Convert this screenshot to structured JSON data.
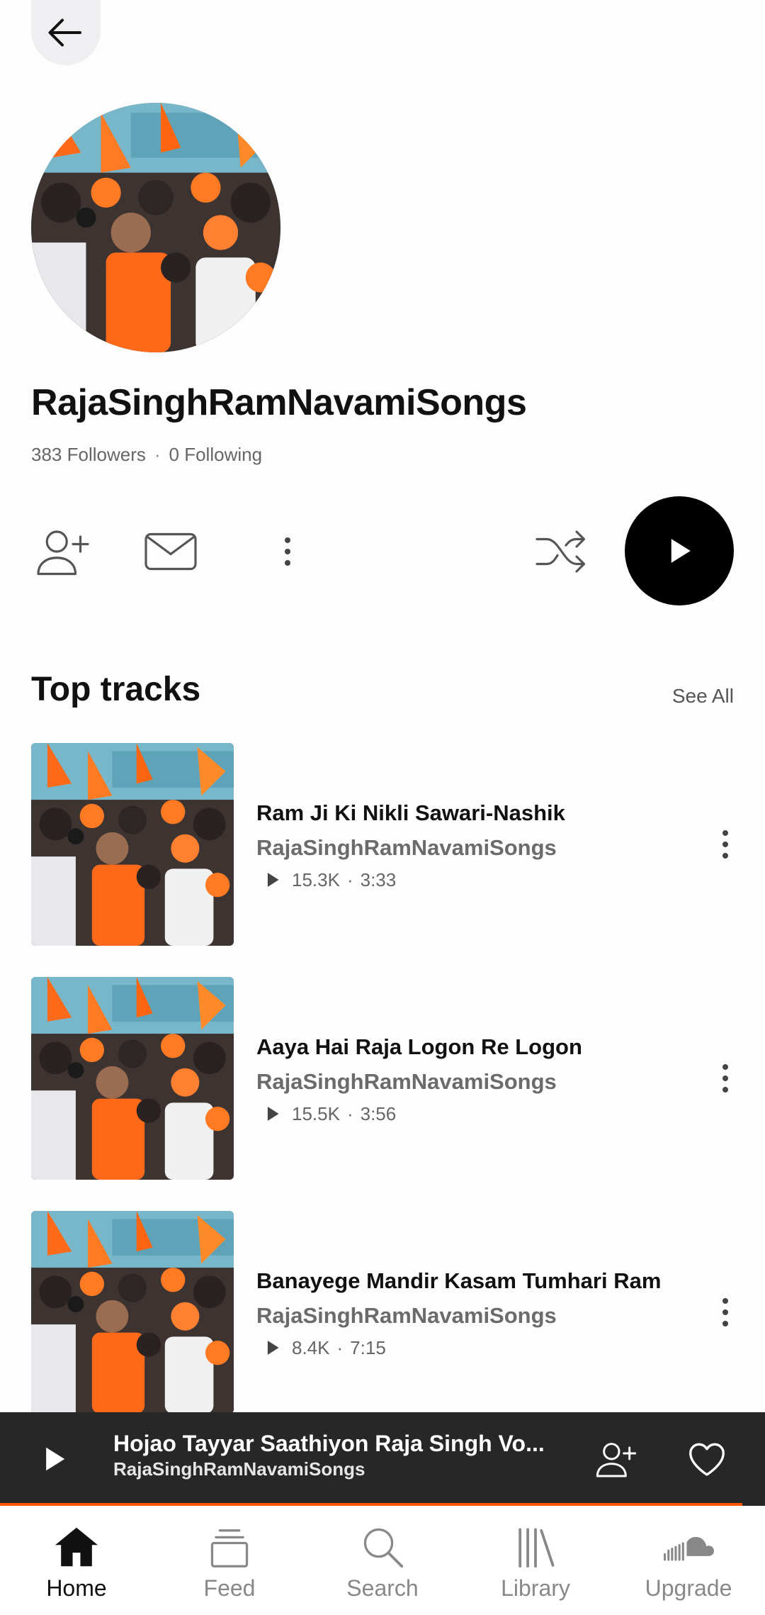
{
  "profile": {
    "name": "RajaSinghRamNavamiSongs",
    "followers": "383 Followers",
    "separator": "·",
    "following": "0 Following"
  },
  "section": {
    "title": "Top tracks",
    "see_all": "See All"
  },
  "tracks": [
    {
      "title": "Ram Ji Ki Nikli Sawari-Nashik",
      "artist": "RajaSinghRamNavamiSongs",
      "plays": "15.3K",
      "duration": "3:33"
    },
    {
      "title": "Aaya Hai Raja Logon Re Logon",
      "artist": "RajaSinghRamNavamiSongs",
      "plays": "15.5K",
      "duration": "3:56"
    },
    {
      "title": "Banayege Mandir Kasam Tumhari Ram",
      "artist": "RajaSinghRamNavamiSongs",
      "plays": "8.4K",
      "duration": "7:15"
    }
  ],
  "stats_separator": "·",
  "now_playing": {
    "title": "Hojao Tayyar Saathiyon Raja Singh Vo...",
    "artist": "RajaSinghRamNavamiSongs",
    "progress_fraction": 0.97
  },
  "nav": {
    "home": "Home",
    "feed": "Feed",
    "search": "Search",
    "library": "Library",
    "upgrade": "Upgrade"
  },
  "colors": {
    "accent": "#ff5500",
    "player_bg": "#272727"
  }
}
